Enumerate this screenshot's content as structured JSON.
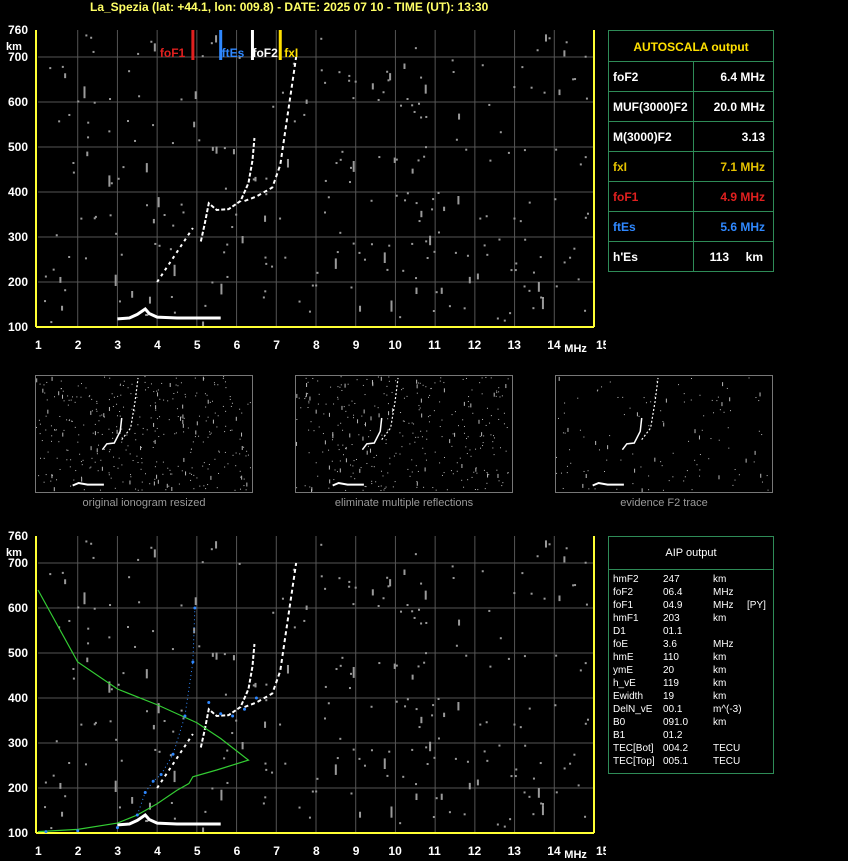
{
  "title": "La_Spezia (lat: +44.1, lon: 009.8) - DATE: 2025 07 10 - TIME (UT): 13:30",
  "colors": {
    "axis": "#ffff33",
    "grid": "#555555",
    "red": "#e0201f",
    "blue": "#2f88ff",
    "yellow": "#ffe000",
    "green": "#33cc33",
    "panel_border": "#2e8b57"
  },
  "ionogram": {
    "y_unit": "km",
    "x_unit": "MHz",
    "y_ticks": [
      "760",
      "700",
      "600",
      "500",
      "400",
      "300",
      "200",
      "100"
    ],
    "x_ticks": [
      "1",
      "2",
      "3",
      "4",
      "5",
      "6",
      "7",
      "8",
      "9",
      "10",
      "11",
      "12",
      "13",
      "14",
      "15"
    ],
    "markers": [
      {
        "label": "foF1",
        "freq": 4.9,
        "color": "#e0201f"
      },
      {
        "label": "ftEs",
        "freq": 5.6,
        "color": "#2f88ff"
      },
      {
        "label": "foF2",
        "freq": 6.4,
        "color": "#ffffff"
      },
      {
        "label": "fxI",
        "freq": 7.1,
        "color": "#ffe000"
      }
    ]
  },
  "autoscala": {
    "header": "AUTOSCALA output",
    "rows": [
      {
        "label": "foF2",
        "value": "6.4 MHz",
        "color": "#ffffff"
      },
      {
        "label": "MUF(3000)F2",
        "value": "20.0 MHz",
        "color": "#ffffff"
      },
      {
        "label": "M(3000)F2",
        "value": "3.13",
        "color": "#ffffff"
      },
      {
        "label": "fxI",
        "value": "7.1 MHz",
        "color": "#e6c200"
      },
      {
        "label": "foF1",
        "value": "4.9 MHz",
        "color": "#e0201f"
      },
      {
        "label": "ftEs",
        "value": "5.6 MHz",
        "color": "#2f88ff"
      },
      {
        "label": "h'Es",
        "value": "113",
        "unit": "km",
        "color": "#ffffff"
      }
    ]
  },
  "thumbnails": [
    {
      "caption": "original ionogram resized"
    },
    {
      "caption": "eliminate multiple reflections"
    },
    {
      "caption": "evidence F2 trace"
    }
  ],
  "aip": {
    "header": "AIP output",
    "rows": [
      [
        "hmF2",
        "247",
        "km",
        ""
      ],
      [
        "foF2",
        "06.4",
        "MHz",
        ""
      ],
      [
        "foF1",
        "04.9",
        "MHz",
        "[PY]"
      ],
      [
        "hmF1",
        "203",
        "km",
        ""
      ],
      [
        "D1",
        "01.1",
        "",
        ""
      ],
      [
        "foE",
        "3.6",
        "MHz",
        ""
      ],
      [
        "hmE",
        "110",
        "km",
        ""
      ],
      [
        "ymE",
        "20",
        "km",
        ""
      ],
      [
        "h_vE",
        "119",
        "km",
        ""
      ],
      [
        "Ewidth",
        "19",
        "km",
        ""
      ],
      [
        "DelN_vE",
        "00.1",
        "m^(-3)",
        ""
      ],
      [
        "B0",
        "091.0",
        "km",
        ""
      ],
      [
        "B1",
        "01.2",
        "",
        ""
      ],
      [
        "TEC[Bot]",
        "004.2",
        "TECU",
        ""
      ],
      [
        "TEC[Top]",
        "005.1",
        "TECU",
        ""
      ]
    ]
  }
}
